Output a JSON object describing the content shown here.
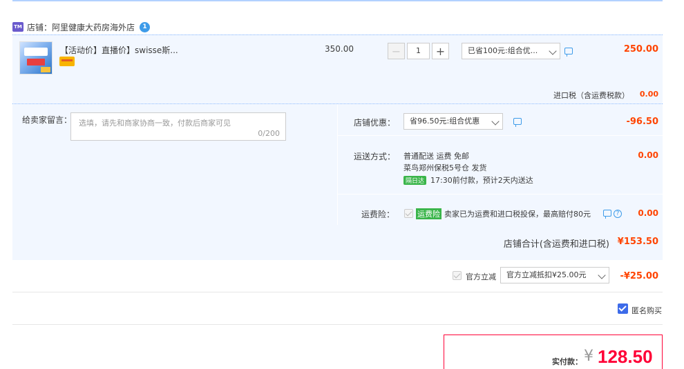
{
  "shop": {
    "icon": "tmall-icon",
    "label": "店铺：",
    "name": "阿里健康大药房海外店",
    "chat_icon": "wangwang-icon",
    "chat_badge": "1"
  },
  "item": {
    "title": "【活动价】直播价】swisse斯...",
    "unit_price": "350.00",
    "quantity": "1",
    "discount_select": "已省100元:组合优...",
    "total": "250.00",
    "import_tax_label": "进口税（含运费税款）",
    "import_tax_value": "0.00"
  },
  "message": {
    "label": "给卖家留言：",
    "placeholder": "选填，请先和商家协商一致，付款后商家可见",
    "count": "0/200"
  },
  "shop_discount": {
    "label": "店铺优惠：",
    "select": "省96.50元:组合优惠",
    "value": "-96.50"
  },
  "shipping": {
    "label": "运送方式：",
    "line1": "普通配送 运费 免邮",
    "line2": "菜鸟郑州保税5号仓  发货",
    "badge": "隔日达",
    "line3": "17:30前付款，预计2天内送达",
    "value": "0.00"
  },
  "insurance": {
    "label": "运费险：",
    "badge": "运费险",
    "text": "卖家已为运费和进口税投保，最高赔付80元",
    "value": "0.00"
  },
  "shop_total": {
    "label": "店铺合计(含运费和进口税)",
    "value": "¥153.50"
  },
  "official": {
    "label": "官方立减",
    "select": "官方立减抵扣¥25.00元",
    "value": "-¥25.00"
  },
  "anonymous": {
    "label": "匿名购买"
  },
  "payment": {
    "label": "实付款：",
    "currency": "¥",
    "amount": "128.50"
  },
  "colors": {
    "accent": "#ff0036",
    "price": "#ff4400",
    "panel_bg": "#f2f7ff",
    "link_blue": "#3d9be9",
    "green_badge": "#3ab54a"
  }
}
